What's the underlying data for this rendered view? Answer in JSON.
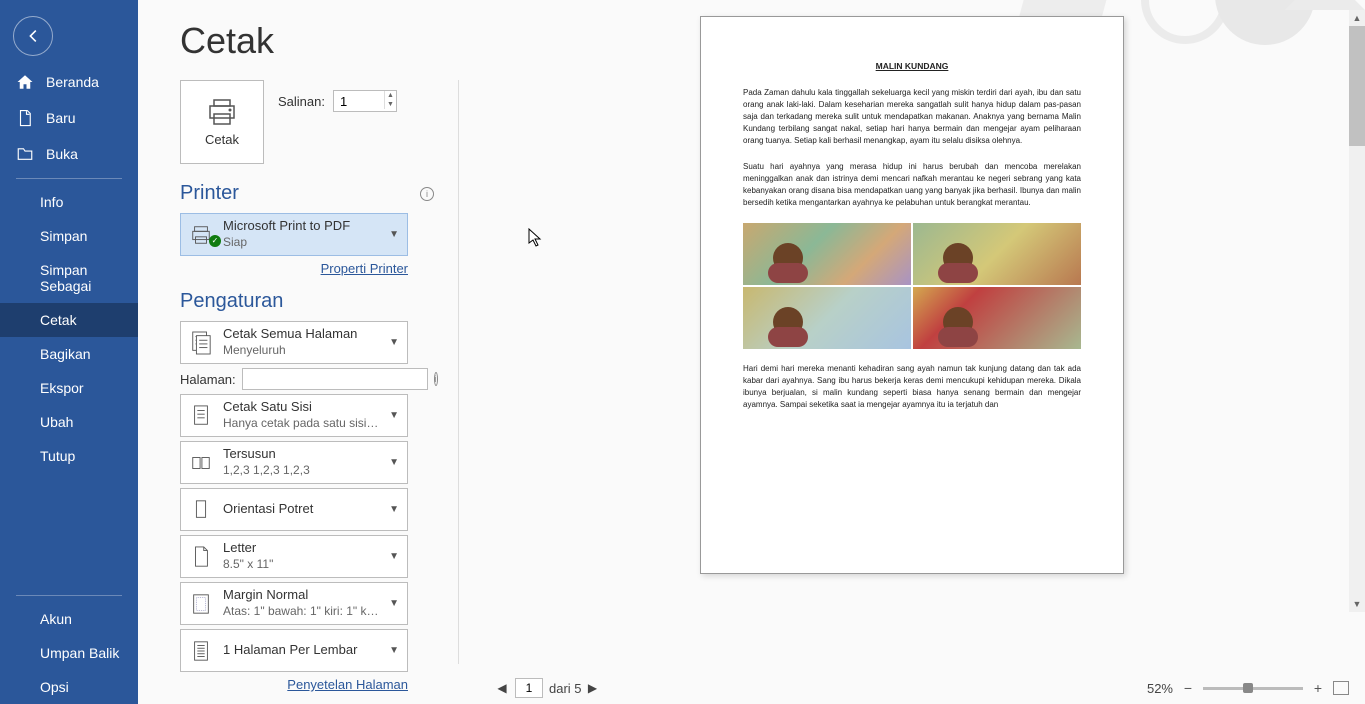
{
  "sidebar": {
    "back_name": "back",
    "main_items": [
      {
        "icon": "home",
        "label": "Beranda"
      },
      {
        "icon": "doc",
        "label": "Baru"
      },
      {
        "icon": "folder",
        "label": "Buka"
      }
    ],
    "sub_items": [
      "Info",
      "Simpan",
      "Simpan Sebagai",
      "Cetak",
      "Bagikan",
      "Ekspor",
      "Ubah",
      "Tutup"
    ],
    "selected_sub": "Cetak",
    "bottom_items": [
      "Akun",
      "Umpan Balik",
      "Opsi"
    ]
  },
  "page_title": "Cetak",
  "print_button": "Cetak",
  "copies": {
    "label": "Salinan:",
    "value": "1"
  },
  "printer": {
    "heading": "Printer",
    "name": "Microsoft Print to PDF",
    "status": "Siap",
    "properties_link": "Properti Printer"
  },
  "settings": {
    "heading": "Pengaturan",
    "print_what": {
      "line1": "Cetak Semua Halaman",
      "line2": "Menyeluruh"
    },
    "pages_label": "Halaman:",
    "pages_value": "",
    "sides": {
      "line1": "Cetak Satu Sisi",
      "line2": "Hanya cetak pada satu sisi h..."
    },
    "collate": {
      "line1": "Tersusun",
      "line2": "1,2,3    1,2,3    1,2,3"
    },
    "orientation": {
      "line1": "Orientasi Potret",
      "line2": ""
    },
    "paper": {
      "line1": "Letter",
      "line2": "8.5\" x 11\""
    },
    "margins": {
      "line1": "Margin Normal",
      "line2": "Atas: 1\" bawah: 1\" kiri: 1\" ka..."
    },
    "per_sheet": {
      "line1": "1 Halaman Per Lembar",
      "line2": ""
    },
    "page_setup_link": "Penyetelan Halaman"
  },
  "preview": {
    "doc_title": "MALIN KUNDANG",
    "p1": "Pada Zaman dahulu kala tinggallah sekeluarga kecil yang miskin terdiri dari ayah, ibu dan satu orang anak laki-laki. Dalam keseharian mereka sangatlah sulit hanya hidup dalam pas-pasan saja dan terkadang mereka sulit untuk mendapatkan makanan. Anaknya yang bernama Malin Kundang terbilang sangat nakal, setiap hari hanya bermain dan mengejar ayam peliharaan orang tuanya. Setiap kali berhasil menangkap, ayam itu selalu disiksa olehnya.",
    "p2": "Suatu hari ayahnya yang merasa hidup ini harus berubah dan mencoba merelakan meninggalkan anak dan istrinya demi mencari nafkah merantau ke negeri sebrang yang kata kebanyakan orang disana bisa mendapatkan uang yang banyak jika berhasil. Ibunya dan malin bersedih ketika mengantarkan ayahnya ke pelabuhan untuk berangkat merantau.",
    "p3": "Hari demi hari mereka menanti kehadiran sang ayah namun tak kunjung datang dan tak ada kabar dari ayahnya. Sang ibu harus bekerja keras demi mencukupi kehidupan mereka. Dikala ibunya berjualan, si malin kundang seperti biasa hanya senang bermain dan mengejar ayamnya. Sampai seketika saat ia mengejar ayamnya itu ia terjatuh dan"
  },
  "footer": {
    "page_current": "1",
    "page_of": "dari 5",
    "zoom": "52%"
  }
}
